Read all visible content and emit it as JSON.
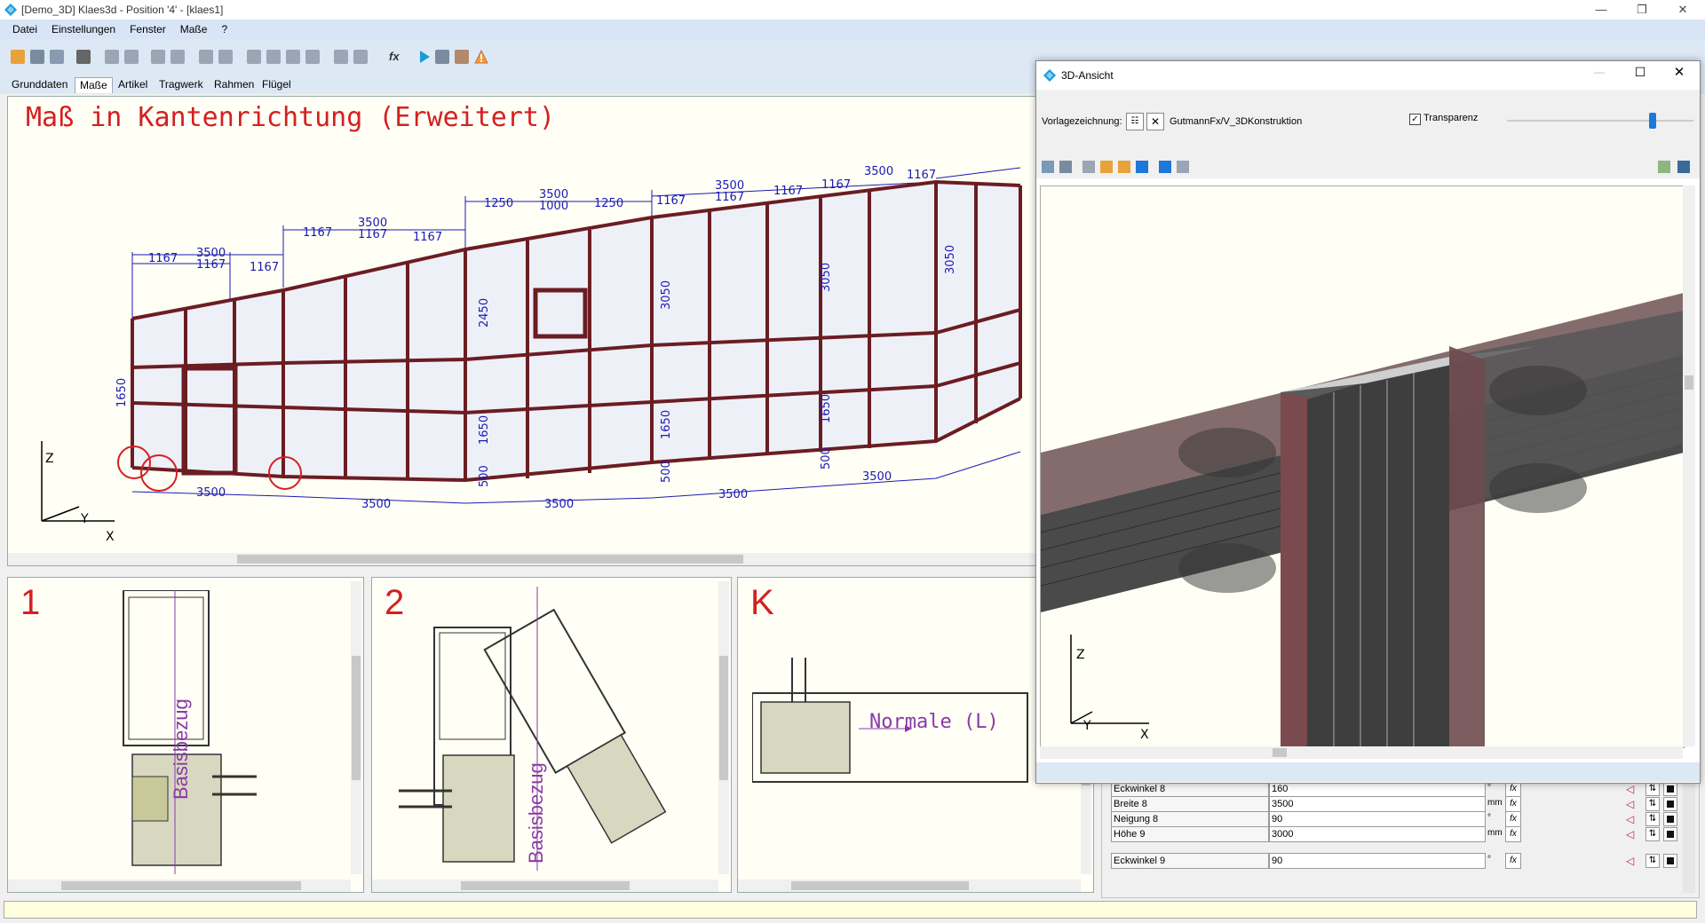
{
  "window": {
    "title": "[Demo_3D] Klaes3d - Position '4' - [klaes1]"
  },
  "menu": [
    "Datei",
    "Einstellungen",
    "Fenster",
    "Maße",
    "?"
  ],
  "tabs": [
    "Grunddaten",
    "Maße",
    "Artikel",
    "Tragwerk",
    "Rahmen",
    "Flügel"
  ],
  "active_tab": "Maße",
  "main_drawing": {
    "title": "Maß in Kantenrichtung (Erweitert)",
    "top_dims": [
      "1167",
      "3500",
      "1167",
      "1167",
      "1167",
      "3500",
      "1167",
      "1167",
      "1250",
      "3500",
      "1000",
      "1250",
      "1167",
      "3500",
      "1167",
      "1167",
      "1167",
      "3500",
      "1167"
    ],
    "bottom_dims": [
      "3500",
      "3500",
      "3500",
      "3500",
      "3500"
    ],
    "vertical_dims": [
      "2450",
      "3050",
      "3050",
      "3050",
      "1650",
      "1650",
      "1650",
      "1650",
      "500",
      "500",
      "500"
    ],
    "axes": {
      "z": "Z",
      "y": "Y",
      "x": "X"
    }
  },
  "details": [
    {
      "label": "1",
      "annotation": "Basisbezug"
    },
    {
      "label": "2",
      "annotation": "Basisbezug"
    },
    {
      "label": "K",
      "annotation": "Normale (L)"
    }
  ],
  "view3d": {
    "title": "3D-Ansicht",
    "template_label": "Vorlagezeichnung:",
    "template_value": "GutmannFx/V_3DKonstruktion",
    "transparency_label": "Transparenz",
    "transparency_checked": true,
    "transparency_level": 0.78,
    "axes": {
      "z": "Z",
      "y": "Y",
      "x": "X"
    }
  },
  "properties": [
    {
      "label": "Eckwinkel 8",
      "value": "160",
      "unit": "°"
    },
    {
      "label": "Breite 8",
      "value": "3500",
      "unit": "mm"
    },
    {
      "label": "Neigung 8",
      "value": "90",
      "unit": "°"
    },
    {
      "label": "Höhe 9",
      "value": "3000",
      "unit": "mm"
    },
    {
      "label": "Eckwinkel 9",
      "value": "90",
      "unit": "°"
    }
  ],
  "fx_label": "fx",
  "colors": {
    "frame": "#6b1d22",
    "dims": "#1a1ab3",
    "title_red": "#d42020",
    "panel_bg": "#fffff6",
    "menu_bg": "#d7e5f6"
  }
}
